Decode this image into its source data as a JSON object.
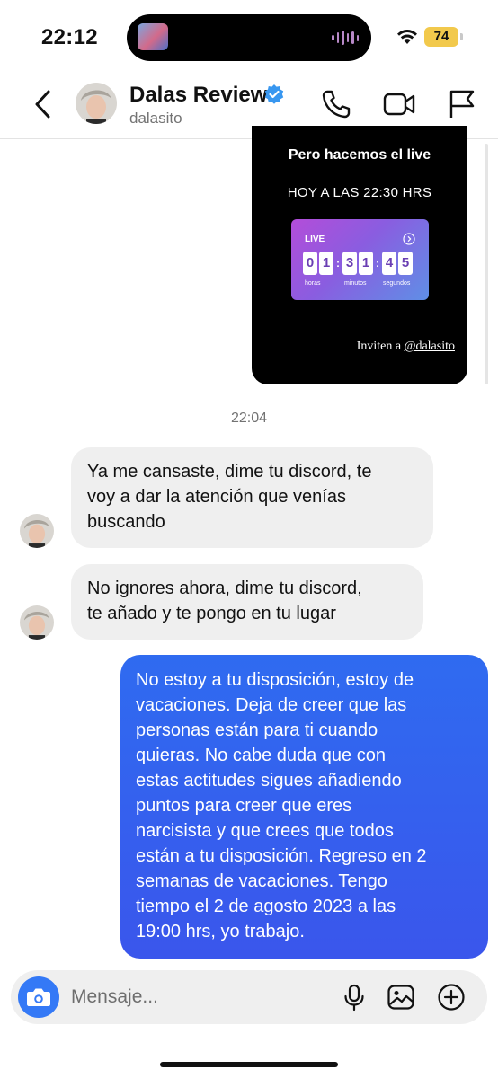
{
  "status_bar": {
    "time": "22:12",
    "battery": "74"
  },
  "header": {
    "name": "Dalas Review",
    "handle": "dalasito",
    "verified": true
  },
  "shared_story": {
    "title": "Pero hacemos el live",
    "subtitle": "HOY A LAS 22:30 HRS",
    "countdown": {
      "label": "LIVE",
      "digits": [
        "0",
        "1",
        "3",
        "1",
        "4",
        "5"
      ],
      "units": [
        "horas",
        "minutos",
        "segundos"
      ]
    },
    "invite_prefix": "Inviten a ",
    "invite_handle": "@dalasito"
  },
  "messages": {
    "timestamp": "22:04",
    "incoming_1": [
      "Ya me cansaste, dime tu discord, te",
      "voy a dar la atención que venías",
      "buscando"
    ],
    "incoming_2": [
      "No ignores ahora, dime tu discord,",
      "te añado y te pongo en tu lugar"
    ],
    "outgoing_1": [
      "No estoy a tu disposición, estoy de",
      "vacaciones. Deja de creer que las",
      "personas están para ti cuando",
      "quieras. No cabe duda que con",
      "estas actitudes sigues añadiendo",
      "puntos para creer que eres",
      "narcisista y que crees que todos",
      "están a tu disposición. Regreso en 2",
      "semanas de vacaciones. Tengo",
      "tiempo el 2 de agosto 2023 a las",
      "19:00 hrs, yo trabajo."
    ]
  },
  "composer": {
    "placeholder": "Mensaje..."
  },
  "colors": {
    "outgoing_bubble": "#3a5ff0",
    "incoming_bubble": "#efefef",
    "camera_button": "#3479f6",
    "verified_badge": "#3897f0",
    "battery": "#f2c94c"
  }
}
